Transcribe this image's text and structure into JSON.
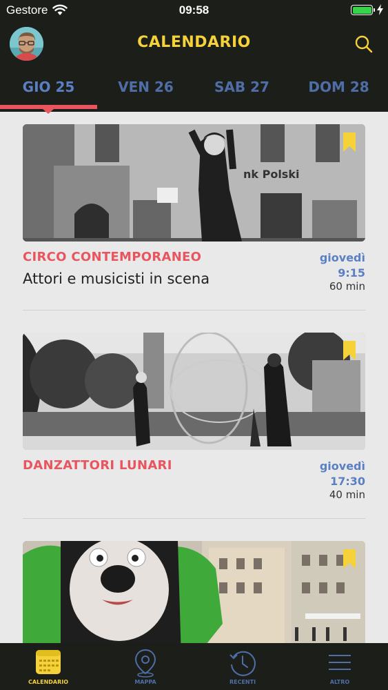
{
  "status_bar": {
    "carrier": "Gestore",
    "time": "09:58",
    "battery_level": 1.0
  },
  "header": {
    "title": "CALENDARIO",
    "avatar_icon": "user-avatar",
    "search_icon": "search-icon"
  },
  "tabs": [
    {
      "label": "GIO 25",
      "active": true
    },
    {
      "label": "VEN 26",
      "active": false
    },
    {
      "label": "SAB 27",
      "active": false
    },
    {
      "label": "DOM 28",
      "active": false
    }
  ],
  "events": [
    {
      "category": "CIRCO CONTEMPORANEO",
      "subtitle": "Attori e musicisti in scena",
      "day": "giovedì",
      "time": "9:15",
      "duration": "60 min",
      "bookmarked": true
    },
    {
      "category": "DANZATTORI LUNARI",
      "subtitle": "",
      "day": "giovedì",
      "time": "17:30",
      "duration": "40 min",
      "bookmarked": true
    },
    {
      "category": "",
      "subtitle": "",
      "day": "",
      "time": "",
      "duration": "",
      "bookmarked": true
    }
  ],
  "bottom_nav": [
    {
      "label": "CALENDARIO",
      "icon": "calendar-icon",
      "active": true
    },
    {
      "label": "MAPPA",
      "icon": "map-pin-icon",
      "active": false
    },
    {
      "label": "RECENTI",
      "icon": "history-icon",
      "active": false
    },
    {
      "label": "ALTRO",
      "icon": "menu-icon",
      "active": false
    }
  ],
  "colors": {
    "bar_background": "#1c1e19",
    "accent_yellow": "#f5d23a",
    "accent_red": "#e8555e",
    "accent_blue": "#5b7fc3",
    "feed_background": "#e9e9ea"
  }
}
